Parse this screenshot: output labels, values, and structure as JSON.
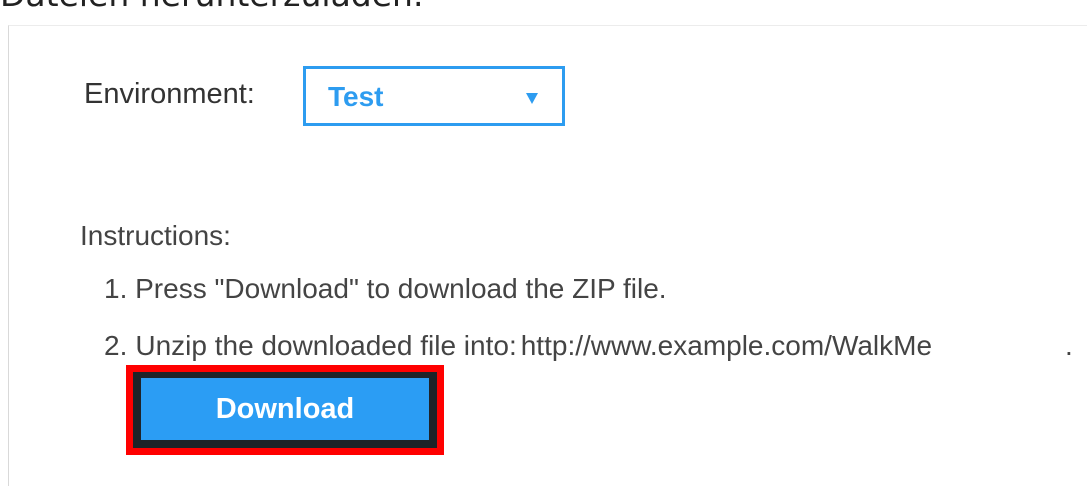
{
  "header": {
    "partial_text": "Dateien herunterzuladen."
  },
  "environment": {
    "label": "Environment:",
    "selected": "Test"
  },
  "instructions": {
    "title": "Instructions:",
    "step1": "1. Press \"Download\" to download the ZIP file.",
    "step2_num": "2.",
    "step2_text": "Unzip the downloaded file into:",
    "step2_url": "http://www.example.com/WalkMe",
    "trailing": "."
  },
  "actions": {
    "download_label": "Download"
  },
  "colors": {
    "accent": "#2d9cf0",
    "button": "#2b9df4",
    "highlight": "#ff0000"
  }
}
